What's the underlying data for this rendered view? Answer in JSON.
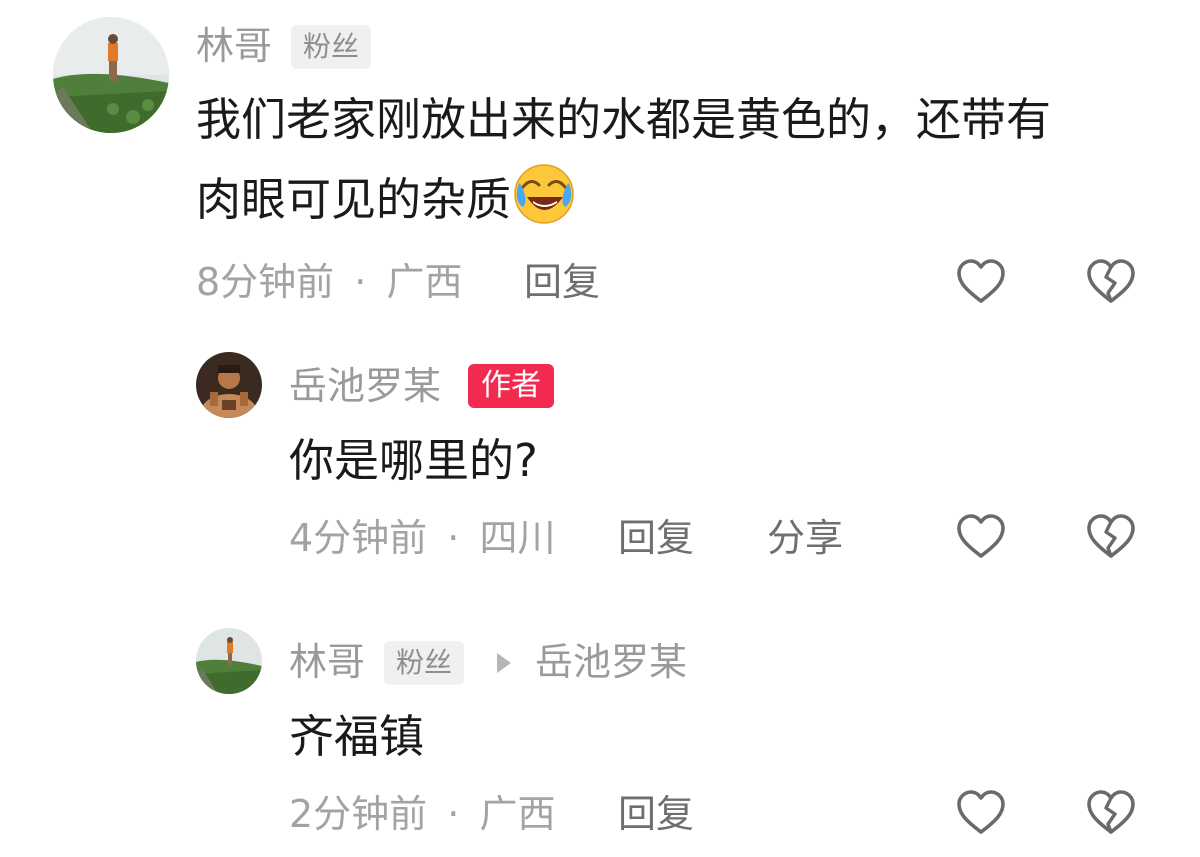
{
  "comments": [
    {
      "username": "林哥",
      "badge": "粉丝",
      "content_line1": "我们老家刚放出来的水都是黄色的，还带有",
      "content_line2": "肉眼可见的杂质",
      "time": "8分钟前",
      "separator": "·",
      "location": "广西",
      "reply_label": "回复",
      "emoji": "face-with-tears-of-joy-icon"
    },
    {
      "username": "岳池罗某",
      "badge": "作者",
      "content": "你是哪里的?",
      "time": "4分钟前",
      "separator": "·",
      "location": "四川",
      "reply_label": "回复",
      "share_label": "分享"
    },
    {
      "username": "林哥",
      "badge": "粉丝",
      "reply_to": "岳池罗某",
      "content": "齐福镇",
      "time": "2分钟前",
      "separator": "·",
      "location": "广西",
      "reply_label": "回复"
    }
  ],
  "colors": {
    "author_badge": "#f22a4f",
    "fan_badge_bg": "#f0f0f0",
    "username": "#9a9a9a",
    "content": "#1a1a1a",
    "meta": "#a3a3a3",
    "icon_stroke": "#6a6a6a"
  },
  "icons": {
    "like": "heart-outline-icon",
    "dislike": "broken-heart-outline-icon"
  }
}
